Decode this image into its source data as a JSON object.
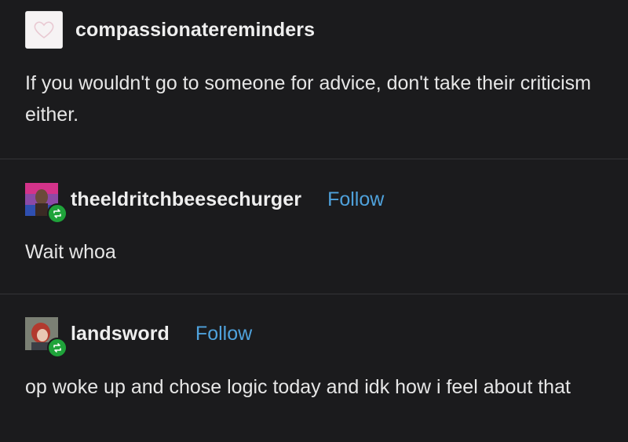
{
  "posts": [
    {
      "username": "compassionatereminders",
      "text": "If you wouldn't go to someone for advice, don't take their criticism either."
    },
    {
      "username": "theeldritchbeesechurger",
      "follow_label": "Follow",
      "text": "Wait whoa"
    },
    {
      "username": "landsword",
      "follow_label": "Follow",
      "text": "op woke up and chose logic today and idk how i feel about that"
    }
  ],
  "icons": {
    "heart_avatar": "heart-icon",
    "reblog": "reblog-icon"
  },
  "colors": {
    "background": "#1b1b1d",
    "follow": "#4fa2dc",
    "reblog_badge": "#1fa33a"
  }
}
